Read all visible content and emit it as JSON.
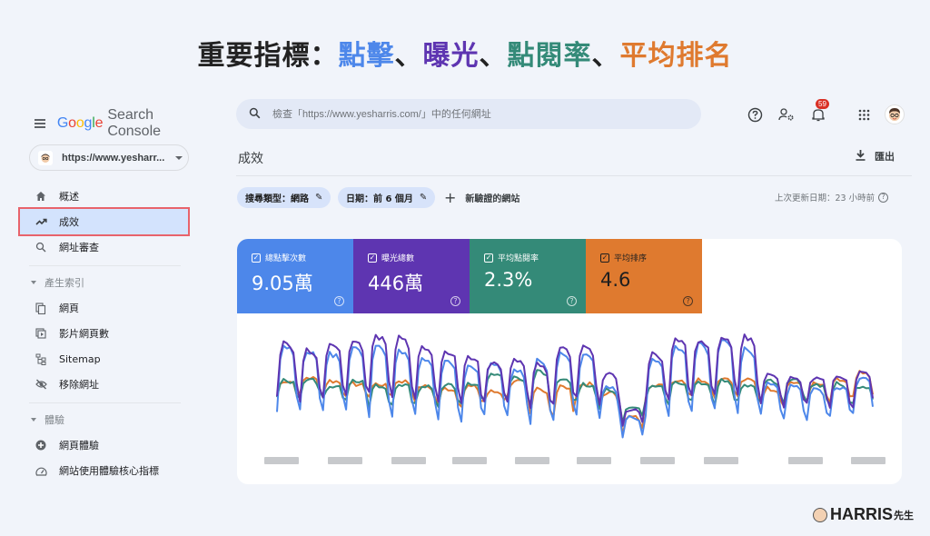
{
  "headline": {
    "prefix": "重要指標：",
    "parts": [
      {
        "text": "點擊",
        "color": "#4d87ea"
      },
      {
        "text": "、",
        "color": "#222222"
      },
      {
        "text": "曝光",
        "color": "#5e35b1"
      },
      {
        "text": "、",
        "color": "#222222"
      },
      {
        "text": "點閱率",
        "color": "#348a78"
      },
      {
        "text": "、",
        "color": "#222222"
      },
      {
        "text": "平均排名",
        "color": "#df7a2f"
      }
    ]
  },
  "app": {
    "logo_google": "Google",
    "logo_product": "Search Console",
    "property": "https://www.yesharr...",
    "search_placeholder": "檢查「https://www.yesharris.com/」中的任何網址",
    "notification_count": "59"
  },
  "sidebar": {
    "items": [
      {
        "label": "概述",
        "icon": "home-icon"
      },
      {
        "label": "成效",
        "icon": "trending-up-icon",
        "active": true
      },
      {
        "label": "網址審查",
        "icon": "search-icon"
      }
    ],
    "sections": [
      {
        "title": "產生索引",
        "items": [
          {
            "label": "網頁",
            "icon": "pages-icon"
          },
          {
            "label": "影片網頁數",
            "icon": "video-pages-icon"
          },
          {
            "label": "Sitemap",
            "icon": "sitemap-icon"
          },
          {
            "label": "移除網址",
            "icon": "visibility-off-icon"
          }
        ]
      },
      {
        "title": "體驗",
        "items": [
          {
            "label": "網頁體驗",
            "icon": "page-experience-icon"
          },
          {
            "label": "網站使用體驗核心指標",
            "icon": "speed-gauge-icon"
          }
        ]
      }
    ]
  },
  "main": {
    "title": "成效",
    "export_label": "匯出",
    "filters": [
      {
        "label": "搜尋類型：網路"
      },
      {
        "label": "日期：前 6 個月"
      }
    ],
    "add_filter_label": "新驗證的網站",
    "last_updated": "上次更新日期：23 小時前"
  },
  "metrics": [
    {
      "label": "總點擊次數",
      "value": "9.05萬",
      "color": "#4d87ea",
      "checked": true
    },
    {
      "label": "曝光總數",
      "value": "446萬",
      "color": "#5e35b1",
      "checked": true
    },
    {
      "label": "平均點閱率",
      "value": "2.3%",
      "color": "#348a78",
      "checked": true
    },
    {
      "label": "平均排序",
      "value": "4.6",
      "color": "#df7a2f",
      "checked": true
    }
  ],
  "chart_data": {
    "type": "line",
    "title": "",
    "xlabel": "",
    "ylabel": "",
    "x_tick_labels_blurred": 10,
    "ylim": [
      0,
      100
    ],
    "grid": false,
    "note": "Relative normalized values (0-100); real axes hidden. ~180 daily points with weekly cycle.",
    "series": [
      {
        "name": "曝光總數",
        "color": "#5e35b1"
      },
      {
        "name": "總點擊次數",
        "color": "#4d87ea"
      },
      {
        "name": "平均點閱率",
        "color": "#348a78"
      },
      {
        "name": "平均排序",
        "color": "#df7a2f"
      }
    ],
    "weeks": [
      {
        "imp_hi": 90,
        "imp_lo": 38,
        "clk_hi": 88,
        "clk_lo": 25,
        "ctr_hi": 55,
        "ctr_lo": 38,
        "pos_hi": 55,
        "pos_lo": 40
      },
      {
        "imp_hi": 83,
        "imp_lo": 34,
        "clk_hi": 82,
        "clk_lo": 24,
        "ctr_hi": 56,
        "ctr_lo": 40,
        "pos_hi": 58,
        "pos_lo": 42
      },
      {
        "imp_hi": 90,
        "imp_lo": 36,
        "clk_hi": 80,
        "clk_lo": 26,
        "ctr_hi": 50,
        "ctr_lo": 38,
        "pos_hi": 55,
        "pos_lo": 42
      },
      {
        "imp_hi": 92,
        "imp_lo": 38,
        "clk_hi": 87,
        "clk_lo": 25,
        "ctr_hi": 56,
        "ctr_lo": 38,
        "pos_hi": 52,
        "pos_lo": 42
      },
      {
        "imp_hi": 96,
        "imp_lo": 40,
        "clk_hi": 88,
        "clk_lo": 20,
        "ctr_hi": 50,
        "ctr_lo": 30,
        "pos_hi": 52,
        "pos_lo": 40
      },
      {
        "imp_hi": 95,
        "imp_lo": 36,
        "clk_hi": 82,
        "clk_lo": 20,
        "ctr_hi": 52,
        "ctr_lo": 32,
        "pos_hi": 55,
        "pos_lo": 42
      },
      {
        "imp_hi": 86,
        "imp_lo": 36,
        "clk_hi": 76,
        "clk_lo": 20,
        "ctr_hi": 50,
        "ctr_lo": 32,
        "pos_hi": 50,
        "pos_lo": 36
      },
      {
        "imp_hi": 83,
        "imp_lo": 34,
        "clk_hi": 74,
        "clk_lo": 18,
        "ctr_hi": 52,
        "ctr_lo": 32,
        "pos_hi": 48,
        "pos_lo": 32
      },
      {
        "imp_hi": 78,
        "imp_lo": 32,
        "clk_hi": 70,
        "clk_lo": 16,
        "ctr_hi": 52,
        "ctr_lo": 34,
        "pos_hi": 50,
        "pos_lo": 32
      },
      {
        "imp_hi": 72,
        "imp_lo": 34,
        "clk_hi": 73,
        "clk_lo": 20,
        "ctr_hi": 62,
        "ctr_lo": 36,
        "pos_hi": 45,
        "pos_lo": 36
      },
      {
        "imp_hi": 76,
        "imp_lo": 34,
        "clk_hi": 66,
        "clk_lo": 22,
        "ctr_hi": 58,
        "ctr_lo": 36,
        "pos_hi": 55,
        "pos_lo": 40
      },
      {
        "imp_hi": 70,
        "imp_lo": 26,
        "clk_hi": 74,
        "clk_lo": 14,
        "ctr_hi": 64,
        "ctr_lo": 30,
        "pos_hi": 48,
        "pos_lo": 22
      },
      {
        "imp_hi": 86,
        "imp_lo": 30,
        "clk_hi": 80,
        "clk_lo": 16,
        "ctr_hi": 56,
        "ctr_lo": 32,
        "pos_hi": 50,
        "pos_lo": 22
      },
      {
        "imp_hi": 86,
        "imp_lo": 36,
        "clk_hi": 80,
        "clk_lo": 22,
        "ctr_hi": 52,
        "ctr_lo": 36,
        "pos_hi": 52,
        "pos_lo": 42
      },
      {
        "imp_hi": 62,
        "imp_lo": 30,
        "clk_hi": 50,
        "clk_lo": 18,
        "ctr_hi": 46,
        "ctr_lo": 30,
        "pos_hi": 44,
        "pos_lo": 30
      },
      {
        "imp_hi": 28,
        "imp_lo": 14,
        "clk_hi": 22,
        "clk_lo": 2,
        "ctr_hi": 30,
        "ctr_lo": 18,
        "pos_hi": 22,
        "pos_lo": 6
      },
      {
        "imp_hi": 80,
        "imp_lo": 36,
        "clk_hi": 74,
        "clk_lo": 22,
        "ctr_hi": 52,
        "ctr_lo": 36,
        "pos_hi": 52,
        "pos_lo": 40
      },
      {
        "imp_hi": 95,
        "imp_lo": 36,
        "clk_hi": 88,
        "clk_lo": 20,
        "ctr_hi": 54,
        "ctr_lo": 34,
        "pos_hi": 56,
        "pos_lo": 40
      },
      {
        "imp_hi": 92,
        "imp_lo": 38,
        "clk_hi": 90,
        "clk_lo": 22,
        "ctr_hi": 54,
        "ctr_lo": 38,
        "pos_hi": 56,
        "pos_lo": 42
      },
      {
        "imp_hi": 96,
        "imp_lo": 40,
        "clk_hi": 94,
        "clk_lo": 26,
        "ctr_hi": 56,
        "ctr_lo": 30,
        "pos_hi": 58,
        "pos_lo": 40
      },
      {
        "imp_hi": 96,
        "imp_lo": 38,
        "clk_hi": 84,
        "clk_lo": 22,
        "ctr_hi": 52,
        "ctr_lo": 36,
        "pos_hi": 56,
        "pos_lo": 40
      },
      {
        "imp_hi": 62,
        "imp_lo": 34,
        "clk_hi": 54,
        "clk_lo": 22,
        "ctr_hi": 56,
        "ctr_lo": 36,
        "pos_hi": 48,
        "pos_lo": 34
      },
      {
        "imp_hi": 58,
        "imp_lo": 30,
        "clk_hi": 50,
        "clk_lo": 18,
        "ctr_hi": 56,
        "ctr_lo": 34,
        "pos_hi": 54,
        "pos_lo": 32
      },
      {
        "imp_hi": 58,
        "imp_lo": 32,
        "clk_hi": 48,
        "clk_lo": 18,
        "ctr_hi": 52,
        "ctr_lo": 34,
        "pos_hi": 52,
        "pos_lo": 36
      },
      {
        "imp_hi": 60,
        "imp_lo": 28,
        "clk_hi": 50,
        "clk_lo": 20,
        "ctr_hi": 52,
        "ctr_lo": 30,
        "pos_hi": 56,
        "pos_lo": 34
      },
      {
        "imp_hi": 64,
        "imp_lo": 30,
        "clk_hi": 58,
        "clk_lo": 24,
        "ctr_hi": 50,
        "ctr_lo": 32,
        "pos_hi": 62,
        "pos_lo": 38
      }
    ]
  },
  "watermark": {
    "text": "HARRIS",
    "suffix": "先生"
  }
}
